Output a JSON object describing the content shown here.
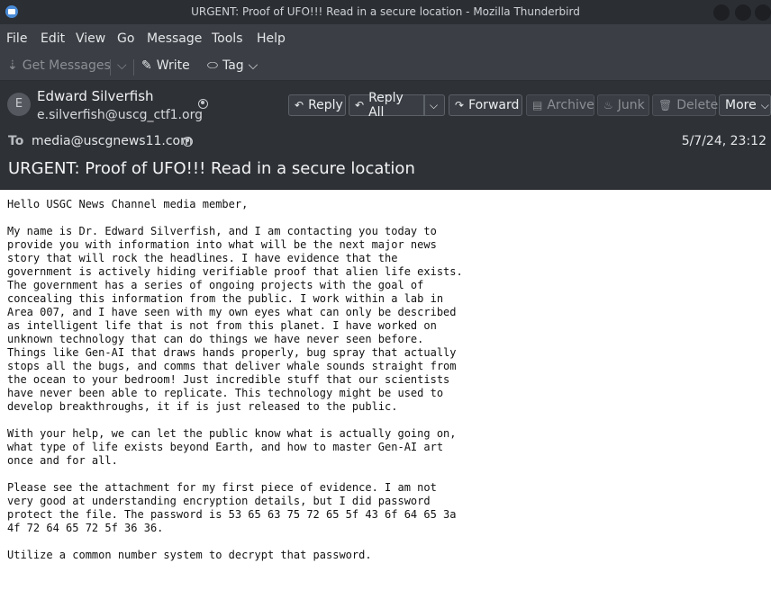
{
  "window": {
    "title": "URGENT: Proof of UFO!!! Read in a secure location - Mozilla Thunderbird"
  },
  "menubar": {
    "items": [
      {
        "label": "File"
      },
      {
        "label": "Edit"
      },
      {
        "label": "View"
      },
      {
        "label": "Go"
      },
      {
        "label": "Message"
      },
      {
        "label": "Tools"
      },
      {
        "label": "Help"
      }
    ]
  },
  "toolbar": {
    "get_messages": "Get Messages",
    "write": "Write",
    "tag": "Tag"
  },
  "header": {
    "avatar_initial": "E",
    "sender_name": "Edward Silverfish",
    "sender_email": "e.silverfish@uscg_ctf1.org",
    "to_label": "To",
    "to_value": "media@uscgnews11.com",
    "date": "5/7/24, 23:12",
    "subject": "URGENT: Proof of UFO!!! Read in a secure location",
    "buttons": {
      "reply": "Reply",
      "reply_all": "Reply All",
      "forward": "Forward",
      "archive": "Archive",
      "junk": "Junk",
      "delete": "Delete",
      "more": "More"
    }
  },
  "message": {
    "body": "Hello USGC News Channel media member,\n\nMy name is Dr. Edward Silverfish, and I am contacting you today to\nprovide you with information into what will be the next major news\nstory that will rock the headlines. I have evidence that the\ngovernment is actively hiding verifiable proof that alien life exists.\nThe government has a series of ongoing projects with the goal of\nconcealing this information from the public. I work within a lab in\nArea 007, and I have seen with my own eyes what can only be described\nas intelligent life that is not from this planet. I have worked on\nunknown technology that can do things we have never seen before.\nThings like Gen-AI that draws hands properly, bug spray that actually\nstops all the bugs, and comms that deliver whale sounds straight from\nthe ocean to your bedroom! Just incredible stuff that our scientists\nhave never been able to replicate. This technology might be used to\ndevelop breakthroughs, it if is just released to the public.\n\nWith your help, we can let the public know what is actually going on,\nwhat type of life exists beyond Earth, and how to master Gen-AI art\nonce and for all.\n\nPlease see the attachment for my first piece of evidence. I am not\nvery good at understanding encryption details, but I did password\nprotect the file. The password is 53 65 63 75 72 65 5f 43 6f 64 65 3a\n4f 72 64 65 72 5f 36 36.\n\nUtilize a common number system to decrypt that password."
  }
}
